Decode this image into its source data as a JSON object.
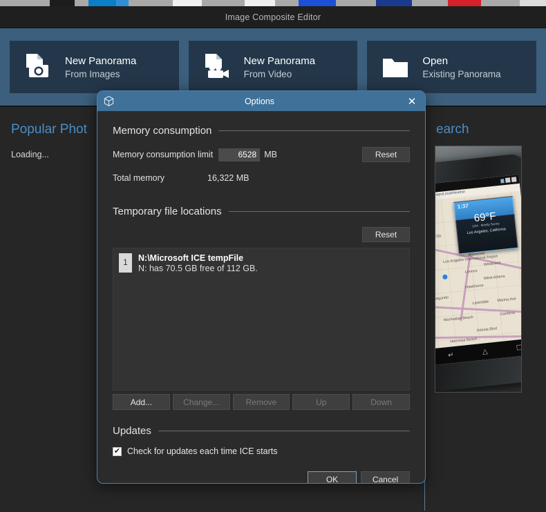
{
  "taskbar": {
    "icon_colors": [
      "#e8e8e8",
      "#1d1d1d",
      "#0a7ec7",
      "#ffffff",
      "#ffffff",
      "#1d4fd8",
      "#1a3a8f",
      "#d6202a",
      "#d8d8d8",
      "#ffffff"
    ]
  },
  "app": {
    "title": "Image Composite Editor",
    "cards": [
      {
        "title": "New Panorama",
        "subtitle": "From Images",
        "icon": "document-camera-icon"
      },
      {
        "title": "New Panorama",
        "subtitle": "From Video",
        "icon": "document-video-camera-icon"
      },
      {
        "title": "Open",
        "subtitle": "Existing Panorama",
        "icon": "folder-icon"
      }
    ],
    "columns": {
      "left_heading": "Popular Phot",
      "left_status": "Loading...",
      "right_heading": "earch"
    },
    "photo": {
      "url_text": "bing.com/maps/Local/Weather",
      "weather_time": "1:37",
      "weather_temp": "69°F",
      "weather_sub": "12/4 · Mostly Sunny",
      "weather_city": "Los Angeles, California",
      "map_labels": [
        "Los Angeles International Airport",
        "Inglewood",
        "Westmont",
        "Lennox",
        "West Athens",
        "Hawthorne",
        "Lawndale",
        "Marina Ave",
        "Gardena",
        "Manhattan Beach",
        "Artesia Blvd",
        "Hermosa Beach",
        "El Segundo",
        "Culver City"
      ]
    }
  },
  "dialog": {
    "title": "Options",
    "app_icon": "cube-icon",
    "close_label": "✕",
    "memory": {
      "section_title": "Memory consumption",
      "limit_label": "Memory consumption limit",
      "limit_value": "6528",
      "limit_unit": "MB",
      "reset_label": "Reset",
      "total_label": "Total memory",
      "total_value": "16,322 MB"
    },
    "temp_files": {
      "section_title": "Temporary file locations",
      "reset_label": "Reset",
      "items": [
        {
          "index": "1",
          "path": "N:\\Microsoft ICE tempFile",
          "detail": "N: has 70.5 GB free of 112 GB."
        }
      ],
      "buttons": [
        {
          "label": "Add...",
          "enabled": true
        },
        {
          "label": "Change...",
          "enabled": false
        },
        {
          "label": "Remove",
          "enabled": false
        },
        {
          "label": "Up",
          "enabled": false
        },
        {
          "label": "Down",
          "enabled": false
        }
      ]
    },
    "updates": {
      "section_title": "Updates",
      "checkbox_label": "Check for updates each time ICE starts",
      "checkbox_checked": true,
      "check_glyph": "✔"
    },
    "footer": {
      "ok_label": "OK",
      "cancel_label": "Cancel"
    }
  },
  "colors": {
    "dialog_titlebar": "#3f7199",
    "dialog_border": "#4d82ad",
    "dialog_bg": "#2b2b2b",
    "hero_bg": "#3b5f7d",
    "card_bg": "#24374a",
    "accent_link": "#4a8ec9",
    "app_bg": "#262626"
  }
}
